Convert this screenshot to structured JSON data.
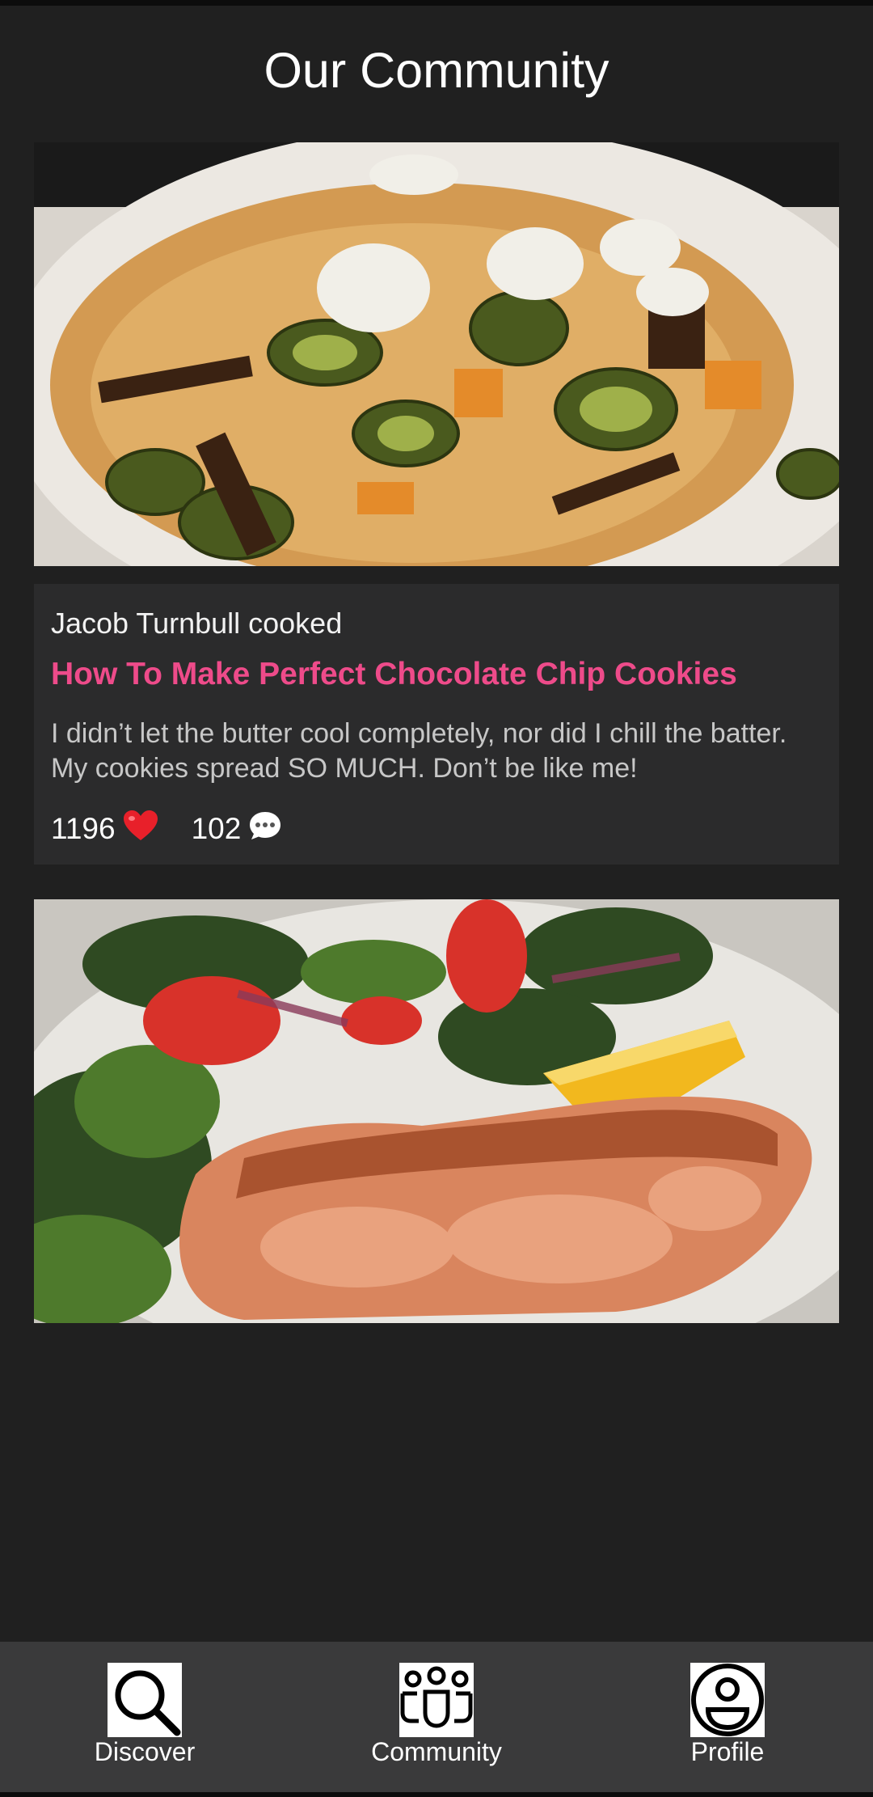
{
  "header": {
    "title": "Our Community"
  },
  "posts": [
    {
      "image_name": "roasted-vegetable-flatbread-photo",
      "author_line": "Jacob Turnbull cooked",
      "recipe_title": "How To Make Perfect Chocolate Chip Cookies",
      "comment": "I didn’t let the butter cool completely, nor did I chill the batter. My cookies spread SO MUCH. Don’t be like me!",
      "likes": "1196",
      "comments": "102",
      "like_icon": "heart-icon",
      "comment_icon": "speech-bubble-icon"
    },
    {
      "image_name": "salmon-salad-photo"
    }
  ],
  "nav": {
    "items": [
      {
        "label": "Discover",
        "icon": "search-icon"
      },
      {
        "label": "Community",
        "icon": "community-icon"
      },
      {
        "label": "Profile",
        "icon": "profile-icon"
      }
    ]
  },
  "colors": {
    "background": "#202020",
    "card": "#2b2b2c",
    "accent": "#ee4b8a",
    "nav_background": "#3a3a3b"
  }
}
